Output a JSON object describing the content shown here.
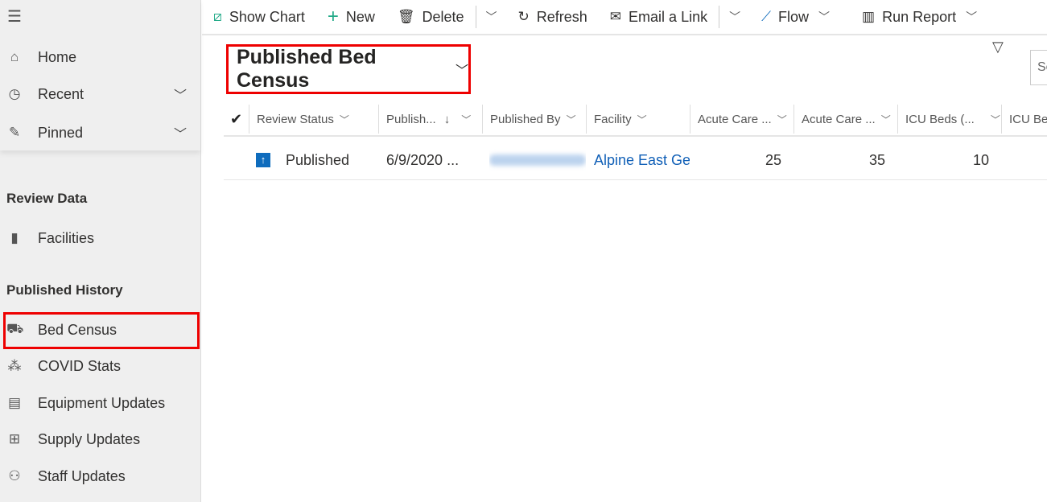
{
  "sidebar": {
    "top": [
      {
        "label": "Home",
        "icon": "home-icon"
      },
      {
        "label": "Recent",
        "icon": "clock-icon"
      },
      {
        "label": "Pinned",
        "icon": "pin-icon"
      }
    ],
    "sections": [
      {
        "title": "Review Data",
        "items": [
          {
            "label": "Facilities",
            "icon": "building-icon"
          }
        ]
      },
      {
        "title": "Published History",
        "items": [
          {
            "label": "Bed Census",
            "icon": "bed-icon",
            "selected": true
          },
          {
            "label": "COVID Stats",
            "icon": "stats-icon"
          },
          {
            "label": "Equipment Updates",
            "icon": "equipment-icon"
          },
          {
            "label": "Supply Updates",
            "icon": "supply-icon"
          },
          {
            "label": "Staff Updates",
            "icon": "staff-icon"
          }
        ]
      }
    ]
  },
  "commands": {
    "show_chart": "Show Chart",
    "new": "New",
    "delete": "Delete",
    "refresh": "Refresh",
    "email_link": "Email a Link",
    "flow": "Flow",
    "run_report": "Run Report"
  },
  "view": {
    "title": "Published Bed Census",
    "search_placeholder": "Se"
  },
  "columns": [
    "Review Status",
    "Publish...",
    "Published By",
    "Facility",
    "Acute Care ...",
    "Acute Care ...",
    "ICU Beds (...",
    "ICU Bed"
  ],
  "rows": [
    {
      "status": "Published",
      "published": "6/9/2020 ...",
      "facility": "Alpine East Ger",
      "acute1": "25",
      "acute2": "35",
      "icu": "10"
    }
  ],
  "colors": {
    "accent": "#0f6cbd",
    "highlight": "#e00000",
    "link": "#1160b7"
  }
}
